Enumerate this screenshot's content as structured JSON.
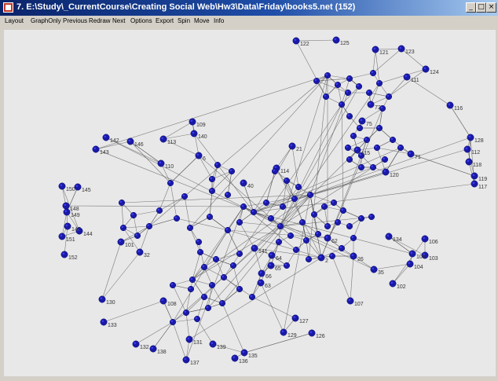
{
  "window": {
    "title": "7. E:\\Study\\_CurrentCourse\\Creating Social Web\\Hw3\\Data\\Friday\\books5.net (152)",
    "minimize_glyph": "_",
    "maximize_glyph": "□",
    "close_glyph": "×"
  },
  "menu": [
    "Layout",
    "GraphOnly",
    "Previous",
    "Redraw",
    "Next",
    "Options",
    "Export",
    "Spin",
    "Move",
    "Info"
  ],
  "colors": {
    "node": "#1a1aa8",
    "node_highlight": "#3b3bf0",
    "edge": "#555555",
    "background": "#e8e8e8"
  },
  "graph": {
    "labels": [
      "122",
      "125",
      "121",
      "123",
      "124",
      "111",
      "116",
      "128",
      "112",
      "118",
      "119",
      "117",
      "109",
      "140",
      "142",
      "146",
      "143",
      "145",
      "150",
      "148",
      "149",
      "147",
      "151",
      "152",
      "144",
      "141",
      "101",
      "32",
      "130",
      "133",
      "132",
      "138",
      "137",
      "131",
      "139",
      "136",
      "135",
      "127",
      "129",
      "126",
      "107",
      "102",
      "104",
      "103",
      "105",
      "106",
      "108",
      "110",
      "113",
      "114",
      "115",
      "120",
      "134",
      "21",
      "6",
      "75",
      "72",
      "71",
      "40",
      "66",
      "63",
      "64",
      "65",
      "35",
      "26",
      "62",
      "2"
    ]
  }
}
